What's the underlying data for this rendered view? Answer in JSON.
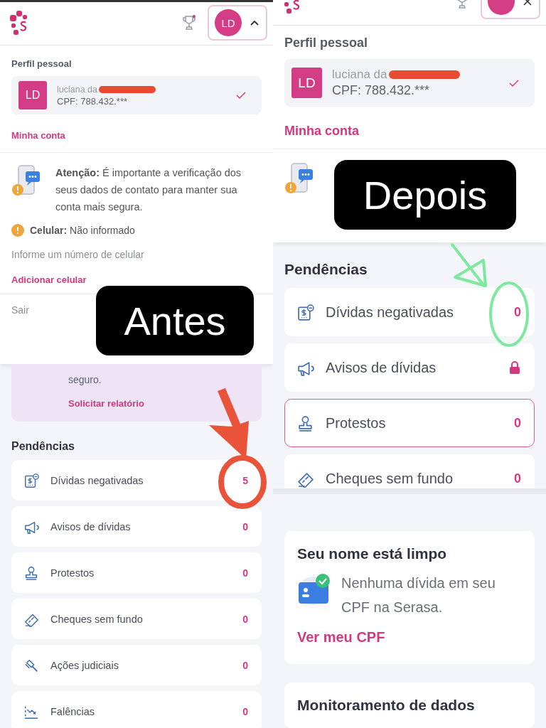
{
  "screens": [
    {
      "annotation": {
        "label": "Antes",
        "color": "#e8533a"
      },
      "blocks": [
        {
          "kind": "header",
          "avatar": "LD"
        },
        {
          "kind": "menu",
          "title": "Perfil pessoal",
          "profile": {
            "initials": "LD",
            "name": "luciana da",
            "cpf": "CPF: 788.432.***",
            "checked": true
          },
          "link": "Minha conta",
          "alert": {
            "text": "**Atenção:** É importante a verificação dos seus dados de contato para manter sua conta mais segura.",
            "phone_status": "**Celular:** Não informado",
            "hint": "Informe um número de celular",
            "action": "Adicionar celular"
          },
          "logout": "Sair"
        },
        {
          "kind": "report",
          "text": "seguro.",
          "link": "Solicitar relatório"
        },
        {
          "kind": "pending",
          "title": "Pendências",
          "items": [
            {
              "kind": "debt",
              "label": "Dívidas negativadas",
              "count": "5",
              "locked": false,
              "selected": false
            },
            {
              "kind": "megaphone",
              "label": "Avisos de dívidas",
              "count": "0",
              "locked": false,
              "selected": false
            },
            {
              "kind": "stamp",
              "label": "Protestos",
              "count": "0",
              "locked": false,
              "selected": false
            },
            {
              "kind": "cheque",
              "label": "Cheques sem fundo",
              "count": "0",
              "locked": false,
              "selected": false
            },
            {
              "kind": "gavel",
              "label": "Ações judiciais",
              "count": "0",
              "locked": false,
              "selected": false
            },
            {
              "kind": "chart",
              "label": "Falências",
              "count": "0",
              "locked": false,
              "selected": false
            }
          ]
        }
      ]
    },
    {
      "annotation": {
        "label": "Depois",
        "color": "#7ee8a0"
      },
      "blocks": [
        {
          "kind": "header"
        },
        {
          "kind": "menu",
          "title": "Perfil pessoal",
          "profile": {
            "initials": "LD",
            "name": "luciana da",
            "cpf": "CPF: 788.432.***",
            "checked": true
          },
          "link": "Minha conta"
        },
        {
          "kind": "pending",
          "title": "Pendências",
          "items": [
            {
              "kind": "debt",
              "label": "Dívidas negativadas",
              "count": "0",
              "locked": false,
              "selected": false
            },
            {
              "kind": "megaphone",
              "label": "Avisos de dívidas",
              "locked": true,
              "selected": false
            },
            {
              "kind": "stamp",
              "label": "Protestos",
              "count": "0",
              "locked": false,
              "selected": true
            },
            {
              "kind": "cheque",
              "label": "Cheques sem fundo",
              "count": "0",
              "locked": false,
              "selected": false
            }
          ]
        },
        {
          "kind": "status-card",
          "title": "Seu nome está limpo",
          "text": "Nenhuma dívida em seu CPF na Serasa.",
          "link": "Ver meu CPF"
        },
        {
          "kind": "status-card",
          "title": "Monitoramento de dados"
        }
      ]
    }
  ]
}
